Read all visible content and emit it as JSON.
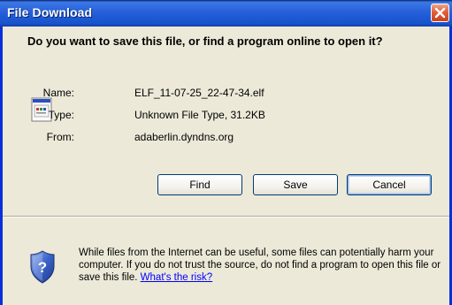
{
  "window": {
    "title": "File Download"
  },
  "dialog": {
    "question": "Do you want to save this file, or find a program online to open it?",
    "file_icon": "unknown-file-icon",
    "info": {
      "name_label": "Name:",
      "name_value": "ELF_11-07-25_22-47-34.elf",
      "type_label": "Type:",
      "type_value": "Unknown File Type, 31.2KB",
      "from_label": "From:",
      "from_value": "adaberlin.dyndns.org"
    },
    "buttons": {
      "find": "Find",
      "save": "Save",
      "cancel": "Cancel"
    },
    "warning": {
      "icon": "security-shield-icon",
      "text": "While files from the Internet can be useful, some files can potentially harm your computer. If you do not trust the source, do not find a program to open this file or save this file. ",
      "link": "What's the risk?"
    }
  },
  "colors": {
    "titlebar": "#2a63da",
    "frame": "#0831d9",
    "dialog_bg": "#ece9d8",
    "close_button": "#e2603b",
    "link": "#0000ff"
  }
}
